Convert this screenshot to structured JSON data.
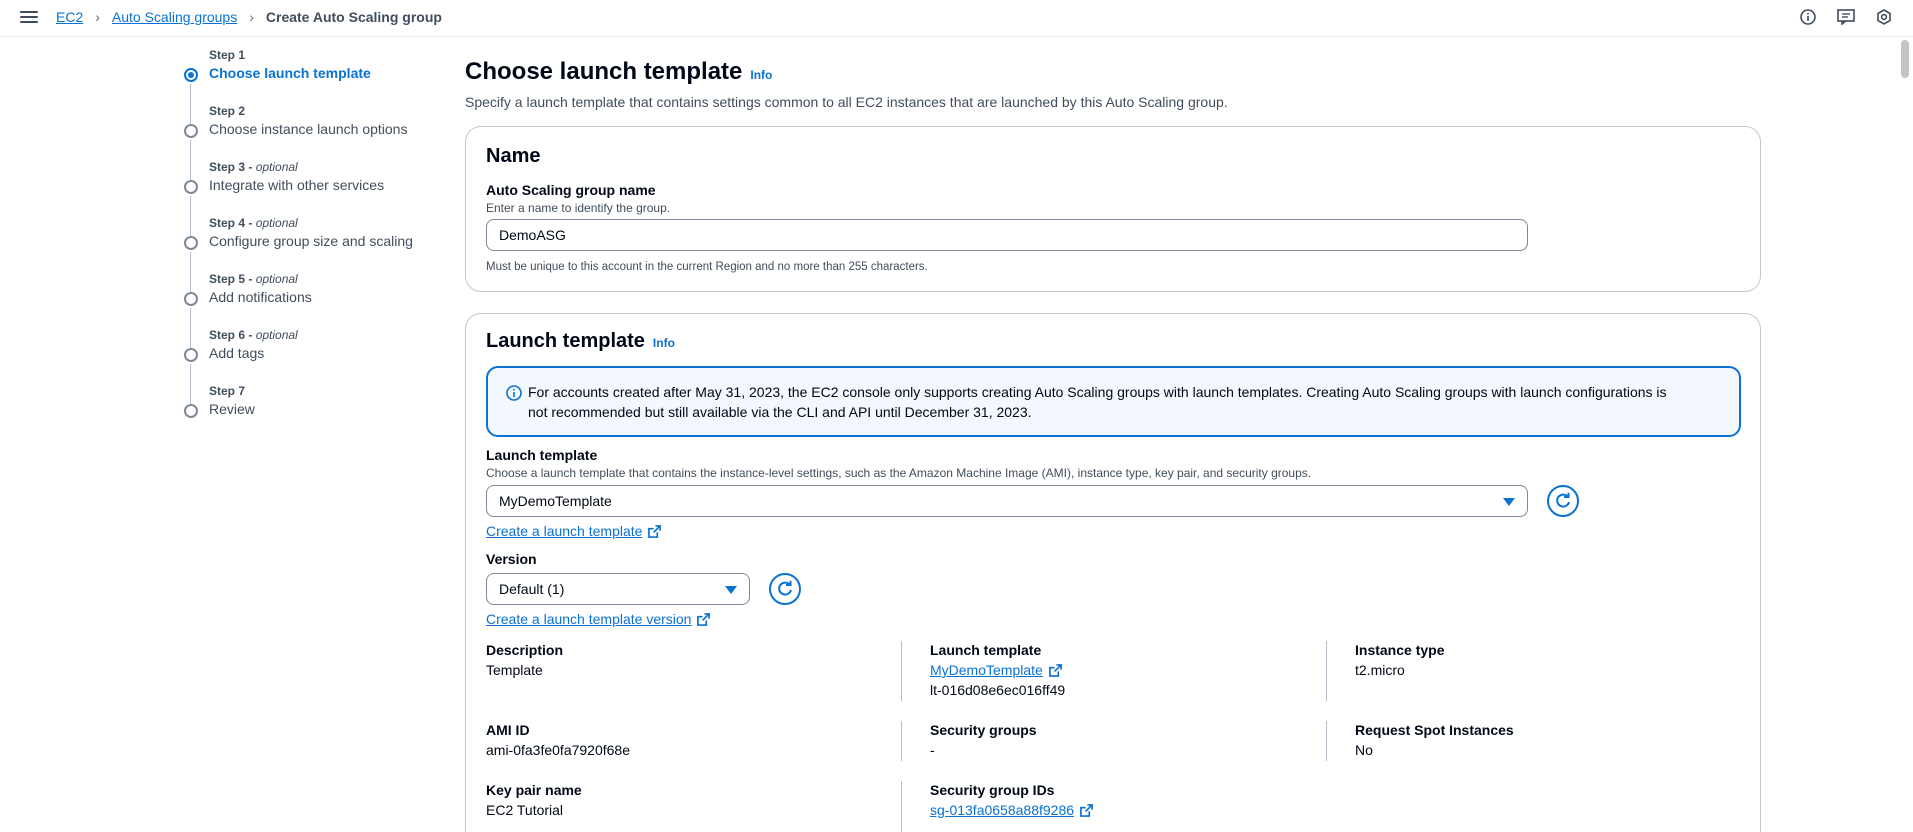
{
  "breadcrumb": {
    "items": [
      "EC2",
      "Auto Scaling groups"
    ],
    "current": "Create Auto Scaling group"
  },
  "steps": [
    {
      "number": "Step 1",
      "optional": "",
      "title": "Choose launch template",
      "active": true
    },
    {
      "number": "Step 2",
      "optional": "",
      "title": "Choose instance launch options",
      "active": false
    },
    {
      "number": "Step 3 - ",
      "optional": "optional",
      "title": "Integrate with other services",
      "active": false
    },
    {
      "number": "Step 4 - ",
      "optional": "optional",
      "title": "Configure group size and scaling",
      "active": false
    },
    {
      "number": "Step 5 - ",
      "optional": "optional",
      "title": "Add notifications",
      "active": false
    },
    {
      "number": "Step 6 - ",
      "optional": "optional",
      "title": "Add tags",
      "active": false
    },
    {
      "number": "Step 7",
      "optional": "",
      "title": "Review",
      "active": false
    }
  ],
  "page": {
    "title": "Choose launch template",
    "info": "Info",
    "description": "Specify a launch template that contains settings common to all EC2 instances that are launched by this Auto Scaling group."
  },
  "name_card": {
    "heading": "Name",
    "field_label": "Auto Scaling group name",
    "field_hint": "Enter a name to identify the group.",
    "field_value": "DemoASG",
    "constraint": "Must be unique to this account in the current Region and no more than 255 characters."
  },
  "lt_card": {
    "heading": "Launch template",
    "info": "Info",
    "alert_line1": "For accounts created after May 31, 2023, the EC2 console only supports creating Auto Scaling groups with launch templates. Creating Auto Scaling groups with launch configurations is",
    "alert_line2": "not recommended but still available via the CLI and API until December 31, 2023.",
    "template_label": "Launch template",
    "template_hint": "Choose a launch template that contains the instance-level settings, such as the Amazon Machine Image (AMI), instance type, key pair, and security groups.",
    "template_value": "MyDemoTemplate",
    "create_template_link": "Create a launch template",
    "version_label": "Version",
    "version_value": "Default (1)",
    "create_version_link": "Create a launch template version",
    "details": {
      "description_k": "Description",
      "description_v": "Template",
      "ami_k": "AMI ID",
      "ami_v": "ami-0fa3fe0fa7920f68e",
      "keypair_k": "Key pair name",
      "keypair_v": "EC2 Tutorial",
      "lt_k": "Launch template",
      "lt_v": "MyDemoTemplate",
      "lt_id": "lt-016d08e6ec016ff49",
      "sg_k": "Security groups",
      "sg_v": "-",
      "sgid_k": "Security group IDs",
      "sgid_v": "sg-013fa0658a88f9286",
      "itype_k": "Instance type",
      "itype_v": "t2.micro",
      "spot_k": "Request Spot Instances",
      "spot_v": "No"
    }
  }
}
